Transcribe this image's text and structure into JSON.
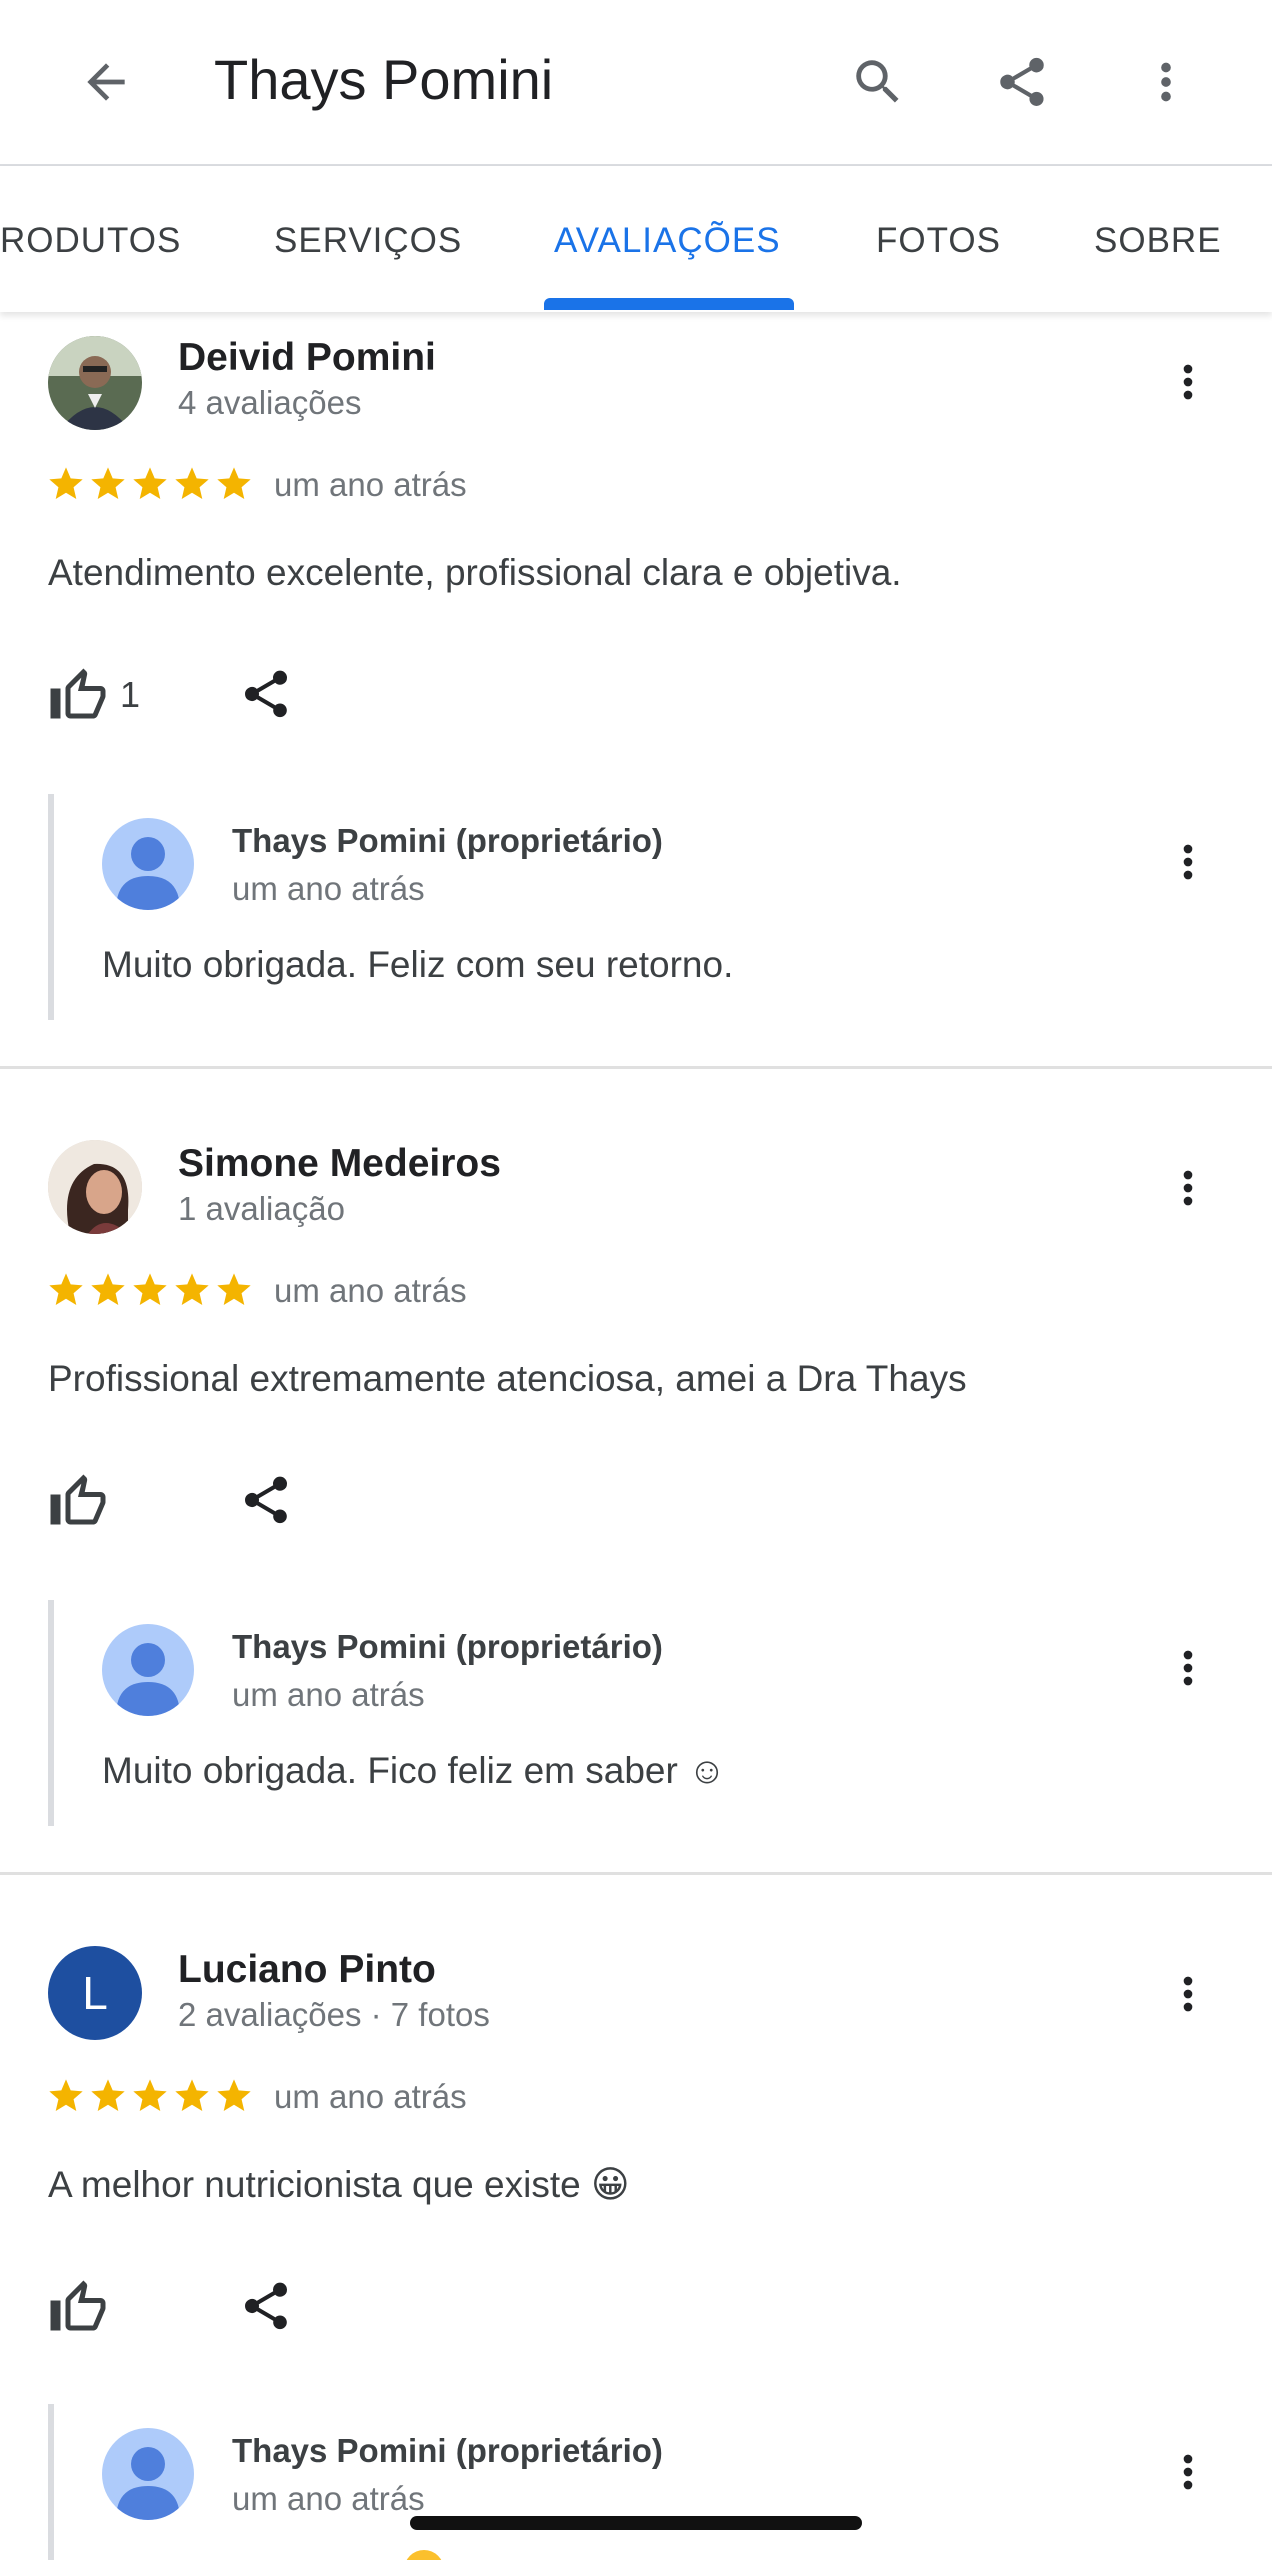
{
  "app_bar": {
    "title": "Thays Pomini",
    "back_icon": "arrow-back-icon",
    "actions": [
      "search-icon",
      "share-icon",
      "more-vert-icon"
    ]
  },
  "tabs": [
    {
      "label": "RODUTOS",
      "active": false
    },
    {
      "label": "SERVIÇOS",
      "active": false
    },
    {
      "label": "AVALIAÇÕES",
      "active": true
    },
    {
      "label": "FOTOS",
      "active": false
    },
    {
      "label": "SOBRE",
      "active": false
    }
  ],
  "reviews": [
    {
      "name": "Deivid Pomini",
      "meta": "4 avaliações",
      "rating": 5,
      "time": "um ano atrás",
      "text": "Atendimento excelente, profissional clara e objetiva.",
      "likes": "1",
      "avatar": "photo",
      "reply": {
        "name": "Thays Pomini (proprietário)",
        "time": "um ano atrás",
        "text": "Muito obrigada. Feliz com seu retorno."
      }
    },
    {
      "name": "Simone Medeiros",
      "meta": "1 avaliação",
      "rating": 5,
      "time": "um ano atrás",
      "text": "Profissional extremamente atenciosa, amei a Dra Thays",
      "likes": "",
      "avatar": "photo",
      "reply": {
        "name": "Thays Pomini (proprietário)",
        "time": "um ano atrás",
        "text": "Muito obrigada. Fico feliz em saber ☺"
      }
    },
    {
      "name": "Luciano Pinto",
      "meta": "2 avaliações · 7 fotos",
      "rating": 5,
      "time": "um ano atrás",
      "text": "A melhor nutricionista que existe 😀",
      "likes": "",
      "avatar": "initial",
      "initial": "L",
      "reply": {
        "name": "Thays Pomini (proprietário)",
        "time": "um ano atrás",
        "text": ""
      }
    }
  ],
  "colors": {
    "accent": "#1a73e8",
    "star": "#f4b400",
    "initial_avatar": "#1e4fa0",
    "owner_avatar": "#aecbfa"
  }
}
